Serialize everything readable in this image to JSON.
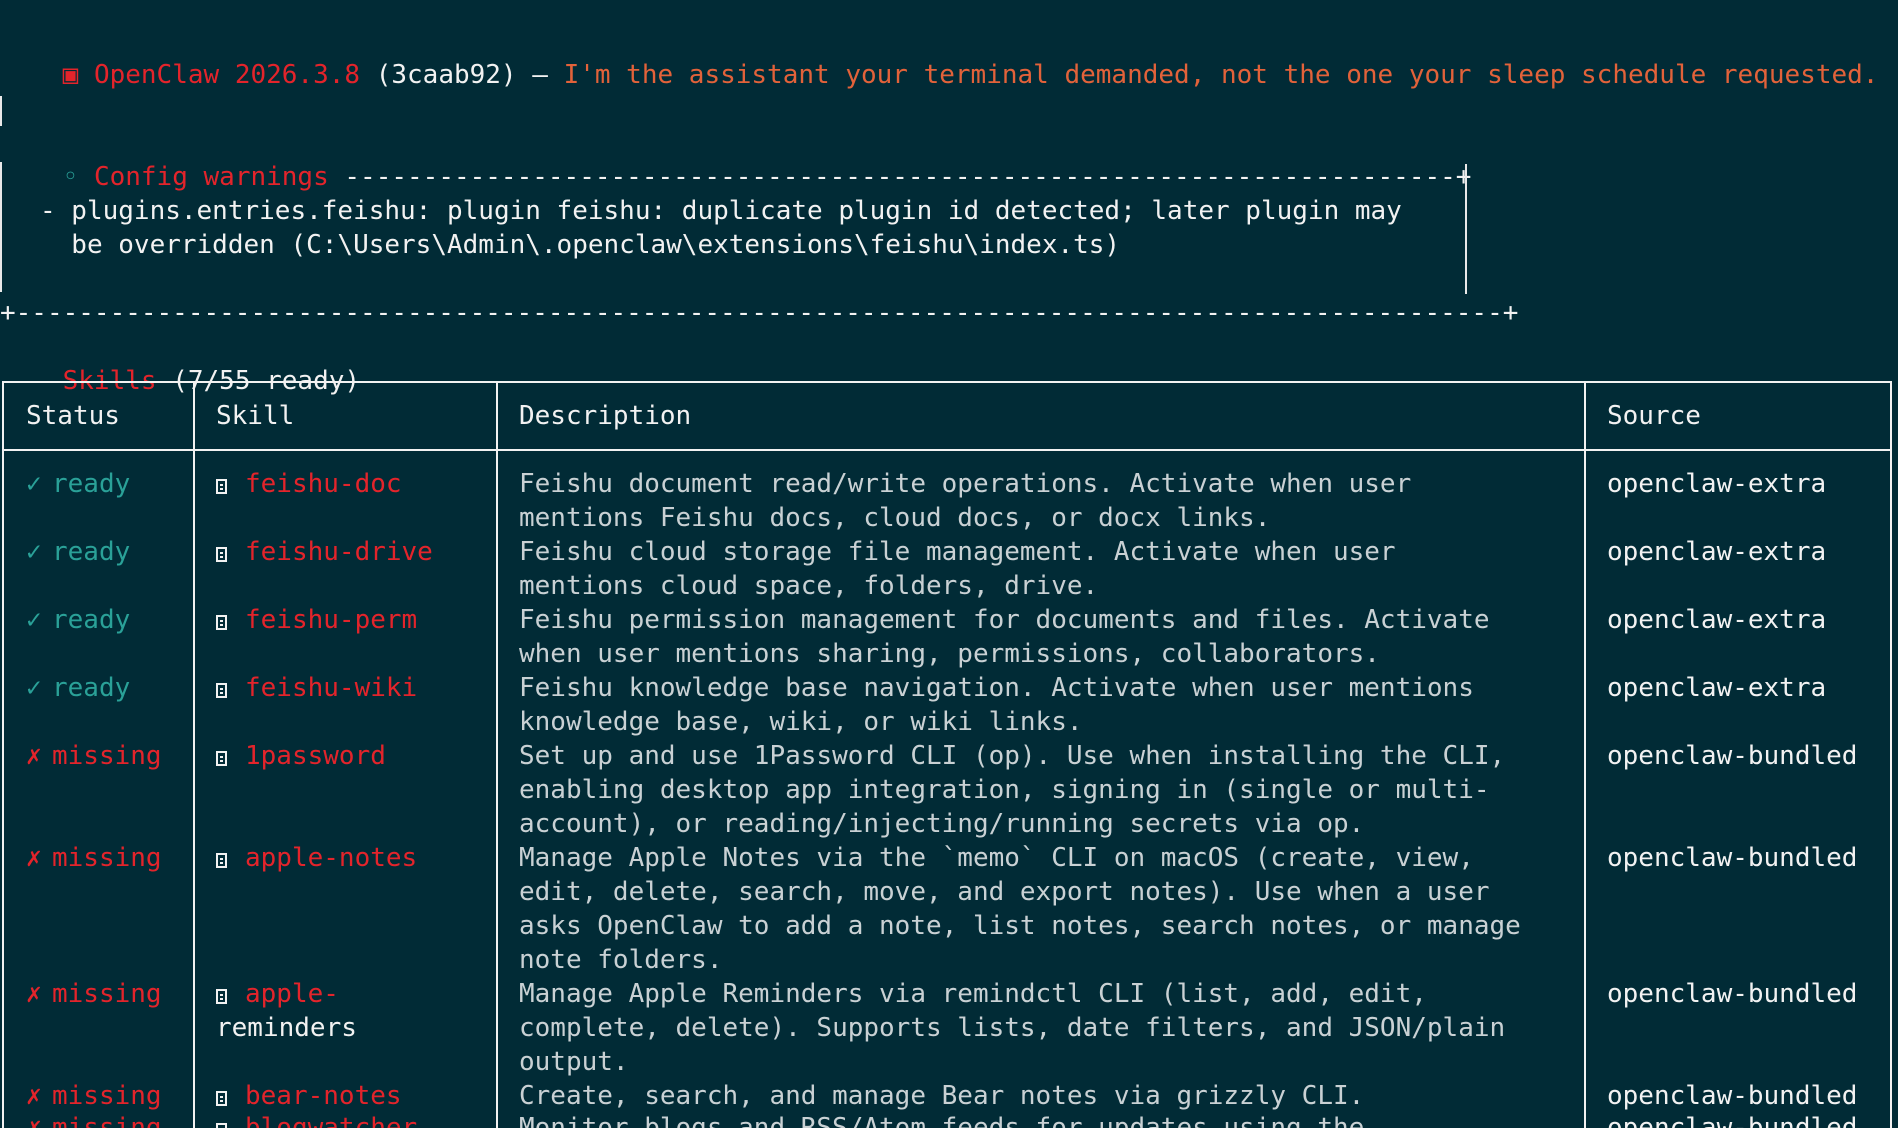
{
  "banner": {
    "app_name": "OpenClaw 2026.3.8",
    "commit": "(3caab92)",
    "dash": "—",
    "tagline": "I'm the assistant your terminal demanded, not the one your sleep schedule requested."
  },
  "config_warnings": {
    "title": "Config warnings",
    "lines": [
      "- plugins.entries.feishu: plugin feishu: duplicate plugin id detected; later plugin may",
      "  be overridden (C:\\Users\\Admin\\.openclaw\\extensions\\feishu\\index.ts)"
    ]
  },
  "skills": {
    "label": "Skills",
    "count": "(7/55 ready)",
    "columns": [
      "Status",
      "Skill",
      "Description",
      "Source"
    ],
    "rows": [
      {
        "status_mark": "✓",
        "status": "ready",
        "skill": "feishu-doc",
        "description": [
          "Feishu document read/write operations. Activate when user",
          "mentions Feishu docs, cloud docs, or docx links."
        ],
        "source": "openclaw-extra"
      },
      {
        "status_mark": "✓",
        "status": "ready",
        "skill": "feishu-drive",
        "description": [
          "Feishu cloud storage file management. Activate when user",
          "mentions cloud space, folders, drive."
        ],
        "source": "openclaw-extra"
      },
      {
        "status_mark": "✓",
        "status": "ready",
        "skill": "feishu-perm",
        "description": [
          "Feishu permission management for documents and files. Activate",
          "when user mentions sharing, permissions, collaborators."
        ],
        "source": "openclaw-extra"
      },
      {
        "status_mark": "✓",
        "status": "ready",
        "skill": "feishu-wiki",
        "description": [
          "Feishu knowledge base navigation. Activate when user mentions",
          "knowledge base, wiki, or wiki links."
        ],
        "source": "openclaw-extra"
      },
      {
        "status_mark": "✗",
        "status": "missing",
        "skill": "1password",
        "description": [
          "Set up and use 1Password CLI (op). Use when installing the CLI,",
          "enabling desktop app integration, signing in (single or multi-",
          "account), or reading/injecting/running secrets via op."
        ],
        "source": "openclaw-bundled"
      },
      {
        "status_mark": "✗",
        "status": "missing",
        "skill": "apple-notes",
        "description": [
          "Manage Apple Notes via the `memo` CLI on macOS (create, view,",
          "edit, delete, search, move, and export notes). Use when a user",
          "asks OpenClaw to add a note, list notes, search notes, or manage",
          "note folders."
        ],
        "source": "openclaw-bundled"
      },
      {
        "status_mark": "✗",
        "status": "missing",
        "skill": "apple-",
        "skill_cont": "reminders",
        "description": [
          "Manage Apple Reminders via remindctl CLI (list, add, edit,",
          "complete, delete). Supports lists, date filters, and JSON/plain",
          "output."
        ],
        "source": "openclaw-bundled"
      },
      {
        "status_mark": "✗",
        "status": "missing",
        "skill": "bear-notes",
        "description": [
          "Create, search, and manage Bear notes via grizzly CLI."
        ],
        "source": "openclaw-bundled"
      },
      {
        "status_mark": "✗",
        "status": "missing",
        "skill": "blogwatcher",
        "description": [
          "Monitor blogs and RSS/Atom feeds for updates using the"
        ],
        "source": "openclaw-bundled"
      }
    ]
  }
}
